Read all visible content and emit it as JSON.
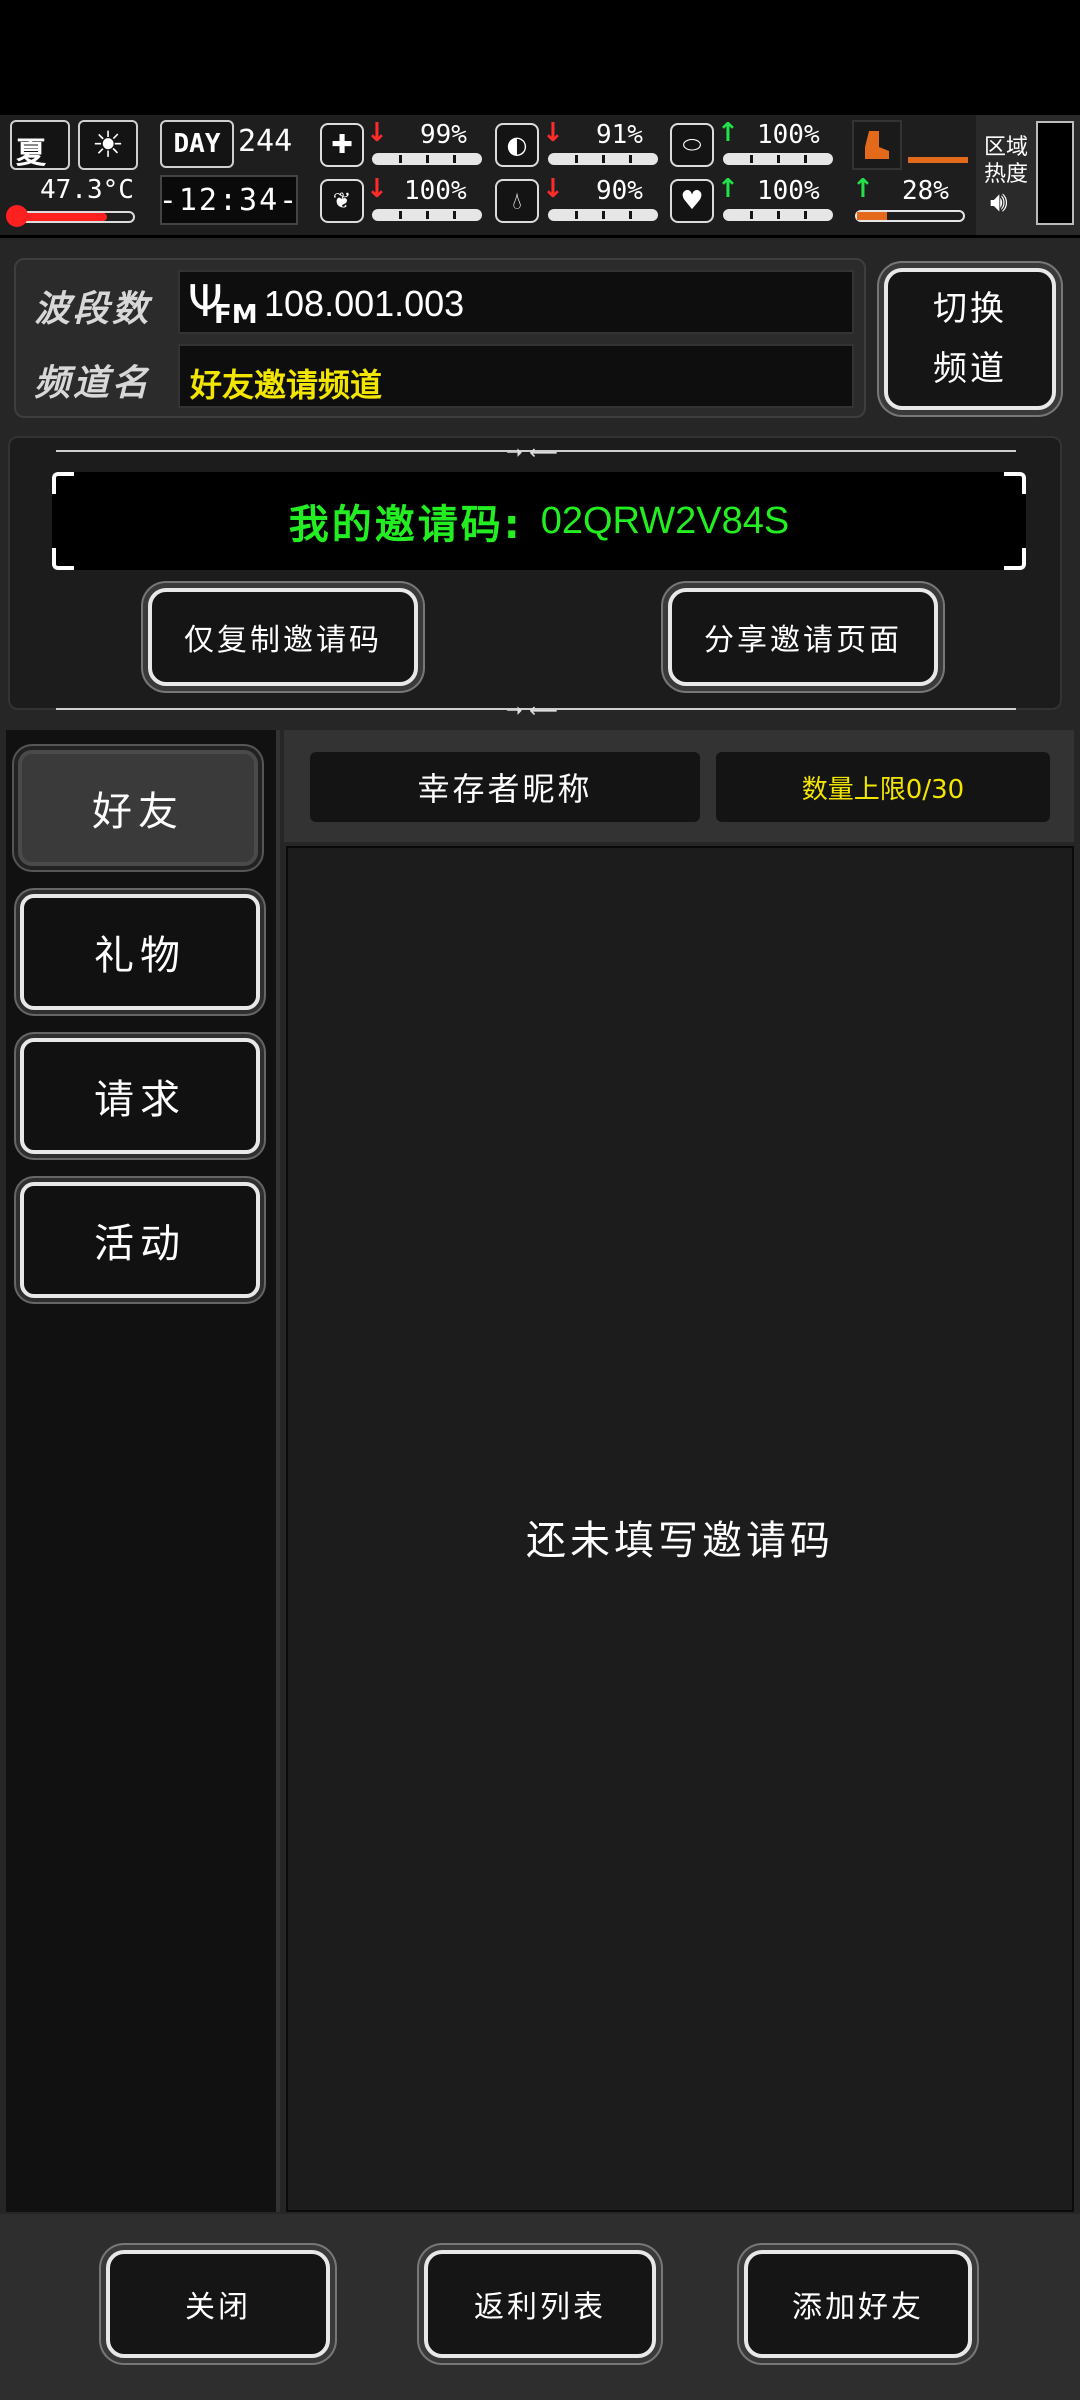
{
  "status": {
    "season": "夏",
    "temperature": "47.3°C",
    "day_label": "DAY",
    "day_number": "244",
    "time": "-12:34-",
    "stats": [
      {
        "name": "health",
        "icon": "medkit-icon",
        "trend": "down",
        "value": "99%"
      },
      {
        "name": "hunger",
        "icon": "stomach-icon",
        "trend": "down",
        "value": "91%"
      },
      {
        "name": "mood",
        "icon": "pill-icon",
        "trend": "up",
        "value": "100%"
      },
      {
        "name": "mental",
        "icon": "brain-icon",
        "trend": "down",
        "value": "100%"
      },
      {
        "name": "thirst",
        "icon": "water-drop-icon",
        "trend": "down",
        "value": "90%"
      },
      {
        "name": "heart",
        "icon": "heart-icon",
        "trend": "up",
        "value": "100%"
      },
      {
        "name": "stamina",
        "icon": "boot-icon",
        "trend": "up",
        "value": "28%"
      }
    ],
    "zone_heat_label_1": "区域",
    "zone_heat_label_2": "热度"
  },
  "radio": {
    "band_label": "波段数",
    "band_prefix": "FM",
    "band_value": "108.001.003",
    "channel_label": "频道名",
    "channel_value": "好友邀请频道",
    "switch_line1": "切换",
    "switch_line2": "频道"
  },
  "invite": {
    "code_label": "我的邀请码:",
    "code_value": "02QRW2V84S",
    "copy_button": "仅复制邀请码",
    "share_button": "分享邀请页面"
  },
  "tabs": [
    "好友",
    "礼物",
    "请求",
    "活动"
  ],
  "list": {
    "col_name": "幸存者昵称",
    "col_limit": "数量上限0/30",
    "empty_message": "还未填写邀请码"
  },
  "footer": {
    "close": "关闭",
    "rebate": "返利列表",
    "add_friend": "添加好友"
  },
  "colors": {
    "green": "#22ee22",
    "yellow": "#f2e500",
    "stat_red": "#ff2a2a",
    "stat_green": "#23e04a",
    "stamina_orange": "#e26a1a"
  }
}
